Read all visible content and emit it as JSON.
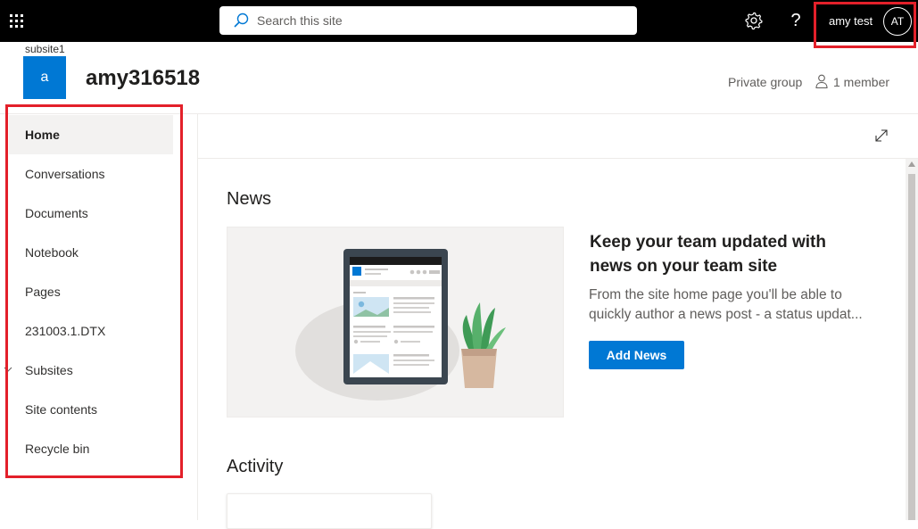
{
  "suitebar": {
    "search_placeholder": "Search this site",
    "user_name": "amy test",
    "user_initials": "AT",
    "help_glyph": "?",
    "icons": [
      "app-launcher-icon",
      "search-icon",
      "gear-icon",
      "help-icon"
    ]
  },
  "site": {
    "parent_link": "subsite1",
    "logo_letter": "a",
    "title": "amy316518",
    "group_type": "Private group",
    "members": "1 member",
    "logo_color": "#0078d4"
  },
  "nav": {
    "items": [
      {
        "label": "Home",
        "selected": true
      },
      {
        "label": "Conversations"
      },
      {
        "label": "Documents"
      },
      {
        "label": "Notebook"
      },
      {
        "label": "Pages"
      },
      {
        "label": "231003.1.DTX"
      },
      {
        "label": "Subsites",
        "expandable": true
      },
      {
        "label": "Site contents"
      },
      {
        "label": "Recycle bin"
      }
    ]
  },
  "news": {
    "title": "News",
    "heading": "Keep your team updated with news on your team site",
    "description_line1": "From the site home page you'll be able to",
    "description_line2": "quickly author a news post - a status updat...",
    "button_label": "Add News"
  },
  "activity": {
    "title": "Activity"
  },
  "colors": {
    "suitebar": "#000000",
    "accent": "#0078d4",
    "highlight": "#e3202a"
  }
}
